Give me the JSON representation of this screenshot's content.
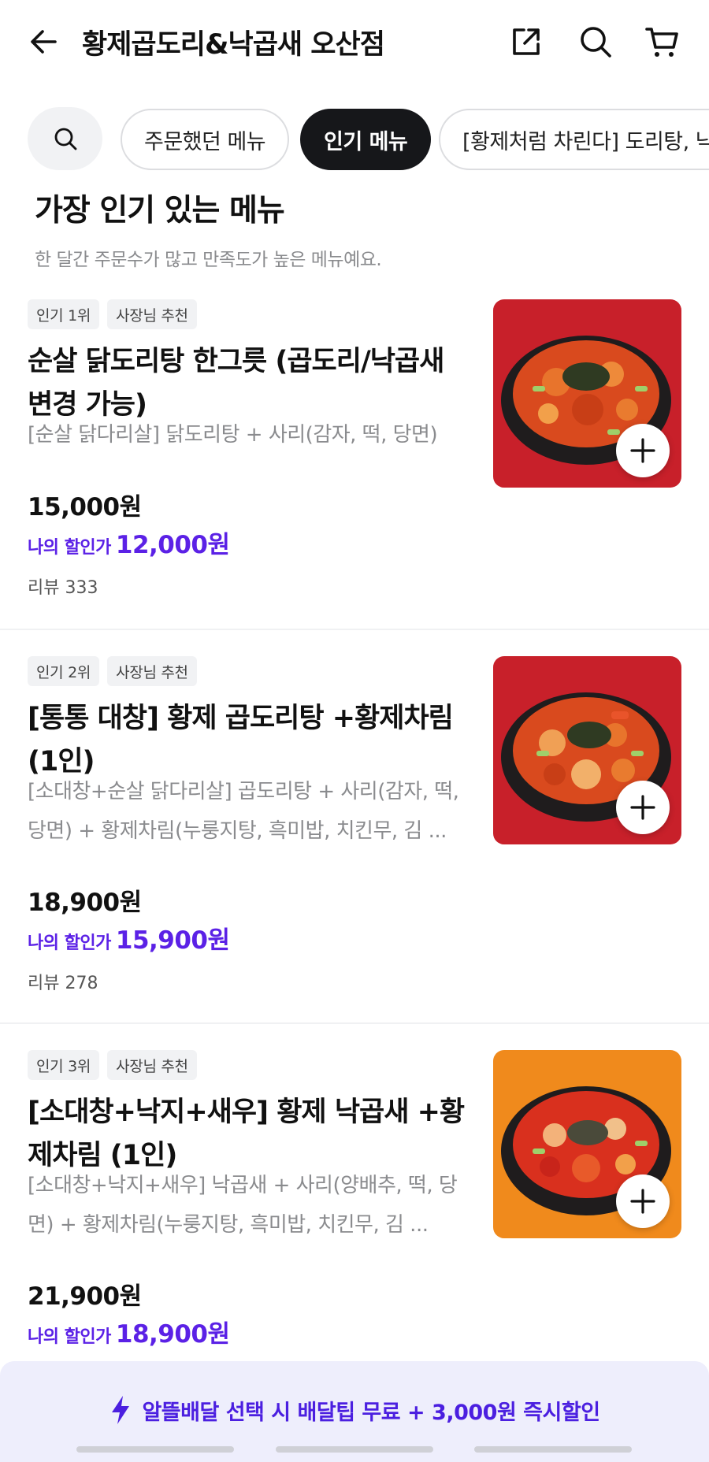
{
  "header": {
    "store_name": "황제곱도리&낙곱새 오산점"
  },
  "chips": [
    {
      "label": "주문했던 메뉴",
      "active": false
    },
    {
      "label": "인기 메뉴",
      "active": true
    },
    {
      "label": "[황제처럼 차린다] 도리탕, 낙",
      "active": false
    }
  ],
  "section": {
    "title": "가장 인기 있는 메뉴",
    "subtitle": "한 달간 주문수가 많고 만족도가 높은 메뉴예요."
  },
  "items": [
    {
      "rank_badge": "인기 1위",
      "rec_badge": "사장님 추천",
      "name": "순살 닭도리탕 한그릇 (곱도리/낙곱새 변경 가능)",
      "desc": "[순살 닭다리살] 닭도리탕 + 사리(감자, 떡, 당면)",
      "price": "15,000원",
      "discount_label": "나의 할인가",
      "discount_price": "12,000원",
      "review": "리뷰 333",
      "image_bg": "#c8202a"
    },
    {
      "rank_badge": "인기 2위",
      "rec_badge": "사장님 추천",
      "name": "[통통 대창] 황제 곱도리탕 +황제차림 (1인)",
      "desc": "[소대창+순살 닭다리살] 곱도리탕 + 사리(감자, 떡, 당면) + 황제차림(누룽지탕, 흑미밥, 치킨무, 김 ...",
      "price": "18,900원",
      "discount_label": "나의 할인가",
      "discount_price": "15,900원",
      "review": "리뷰 278",
      "image_bg": "#c8202a"
    },
    {
      "rank_badge": "인기 3위",
      "rec_badge": "사장님 추천",
      "name": "[소대창+낙지+새우] 황제 낙곱새 +황제차림 (1인)",
      "desc": "[소대창+낙지+새우] 낙곱새 + 사리(양배추, 떡, 당면) + 황제차림(누룽지탕, 흑미밥, 치킨무, 김 ...",
      "price": "21,900원",
      "discount_label": "나의 할인가",
      "discount_price": "18,900원",
      "review": "",
      "image_bg": "#f08a1c"
    }
  ],
  "promo": {
    "text": "알뜰배달 선택 시 배달팁 무료 + 3,000원 즉시할인"
  },
  "colors": {
    "accent": "#5b21e6",
    "promo_bg": "#eeeefc"
  }
}
